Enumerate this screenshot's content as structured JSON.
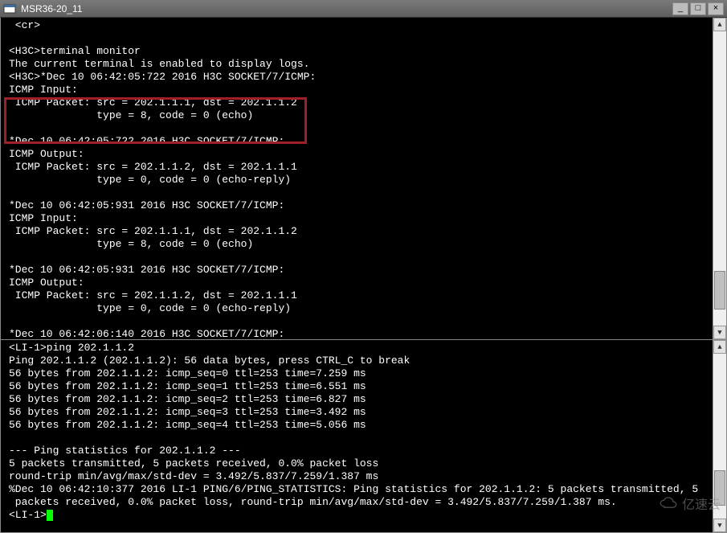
{
  "window": {
    "title": "MSR36-20_11",
    "min_symbol": "_",
    "max_symbol": "□",
    "close_symbol": "×"
  },
  "top_pane": {
    "lines": [
      " <cr>",
      "",
      "<H3C>terminal monitor",
      "The current terminal is enabled to display logs.",
      "<H3C>*Dec 10 06:42:05:722 2016 H3C SOCKET/7/ICMP:",
      "ICMP Input:",
      " ICMP Packet: src = 202.1.1.1, dst = 202.1.1.2",
      "              type = 8, code = 0 (echo)",
      "",
      "*Dec 10 06:42:05:722 2016 H3C SOCKET/7/ICMP:",
      "ICMP Output:",
      " ICMP Packet: src = 202.1.1.2, dst = 202.1.1.1",
      "              type = 0, code = 0 (echo-reply)",
      "",
      "*Dec 10 06:42:05:931 2016 H3C SOCKET/7/ICMP:",
      "ICMP Input:",
      " ICMP Packet: src = 202.1.1.1, dst = 202.1.1.2",
      "              type = 8, code = 0 (echo)",
      "",
      "*Dec 10 06:42:05:931 2016 H3C SOCKET/7/ICMP:",
      "ICMP Output:",
      " ICMP Packet: src = 202.1.1.2, dst = 202.1.1.1",
      "              type = 0, code = 0 (echo-reply)",
      "",
      "*Dec 10 06:42:06:140 2016 H3C SOCKET/7/ICMP:"
    ]
  },
  "bottom_pane": {
    "prompt_start": "<LI-1>",
    "cmd": "ping 202.1.1.2",
    "lines": [
      "Ping 202.1.1.2 (202.1.1.2): 56 data bytes, press CTRL_C to break",
      "56 bytes from 202.1.1.2: icmp_seq=0 ttl=253 time=7.259 ms",
      "56 bytes from 202.1.1.2: icmp_seq=1 ttl=253 time=6.551 ms",
      "56 bytes from 202.1.1.2: icmp_seq=2 ttl=253 time=6.827 ms",
      "56 bytes from 202.1.1.2: icmp_seq=3 ttl=253 time=3.492 ms",
      "56 bytes from 202.1.1.2: icmp_seq=4 ttl=253 time=5.056 ms",
      "",
      "--- Ping statistics for 202.1.1.2 ---",
      "5 packets transmitted, 5 packets received, 0.0% packet loss",
      "round-trip min/avg/max/std-dev = 3.492/5.837/7.259/1.387 ms",
      "%Dec 10 06:42:10:377 2016 LI-1 PING/6/PING_STATISTICS: Ping statistics for 202.1.1.2: 5 packets transmitted, 5",
      " packets received, 0.0% packet loss, round-trip min/avg/max/std-dev = 3.492/5.837/7.259/1.387 ms."
    ],
    "prompt_end": "<LI-1>"
  },
  "watermark": {
    "text": "亿速云"
  }
}
